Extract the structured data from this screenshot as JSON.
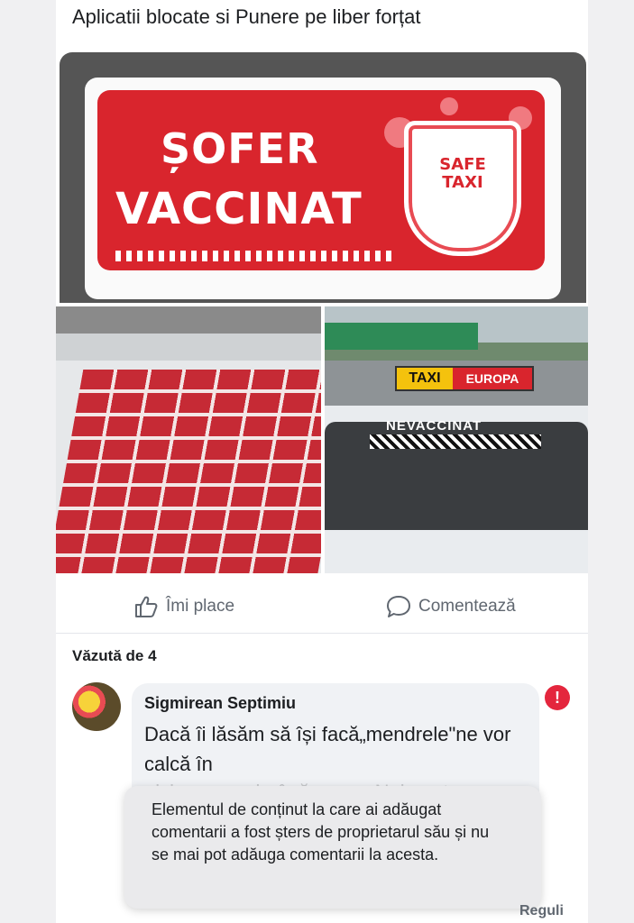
{
  "post": {
    "text": "Aplicatii blocate si Punere pe liber forțat"
  },
  "banner": {
    "line1": "ȘOFER",
    "line2": "VACCINAT",
    "badge_line1": "SAFE",
    "badge_line2": "TAXI"
  },
  "photo_right": {
    "sign_left": "TAXI",
    "sign_right": "EUROPA",
    "window_text": "NEVACCINAT"
  },
  "actions": {
    "like_label": "Îmi place",
    "comment_label": "Comentează"
  },
  "seen_by": "Văzută de 4",
  "comment": {
    "author": "Sigmirean Septimiu",
    "text": "Dacă îi lăsăm să își facă„mendrele\"ne vor calcă în",
    "text_faded": "picioare ca și până acum. Noi pentru"
  },
  "toast": {
    "message": "Elementul de conținut la care ai adăugat comentarii a fost șters de proprietarul său și nu se mai pot adăuga comentarii la acesta."
  },
  "footer": {
    "rules_label": "Reguli"
  },
  "colors": {
    "brand_red": "#d9252d",
    "error_red": "#e4263d",
    "secondary_text": "#606770"
  }
}
